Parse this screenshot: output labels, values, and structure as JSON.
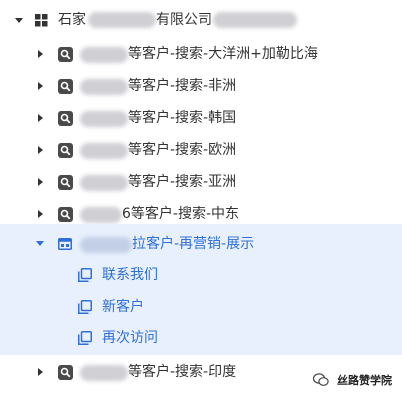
{
  "root": {
    "label_start": "石家",
    "label_end": "有限公司"
  },
  "groups": [
    {
      "label": "等客户-搜索-大洋洲+加勒比海"
    },
    {
      "label": "等客户-搜索-非洲"
    },
    {
      "label": "等客户-搜索-韩国"
    },
    {
      "label": "等客户-搜索-欧洲"
    },
    {
      "label": "等客户-搜索-亚洲"
    },
    {
      "label": "6等客户-搜索-中东"
    }
  ],
  "expanded_group": {
    "label": "拉客户-再营销-展示",
    "children": [
      {
        "label": "联系我们"
      },
      {
        "label": "新客户"
      },
      {
        "label": "再次访问"
      }
    ]
  },
  "last_group": {
    "label": "等客户-搜索-印度"
  },
  "watermark": {
    "text": "丝路赞学院"
  },
  "colors": {
    "accent": "#2f6fd6",
    "selected_bg": "#e8f0fd",
    "icon_dark": "#4a4a4a"
  }
}
